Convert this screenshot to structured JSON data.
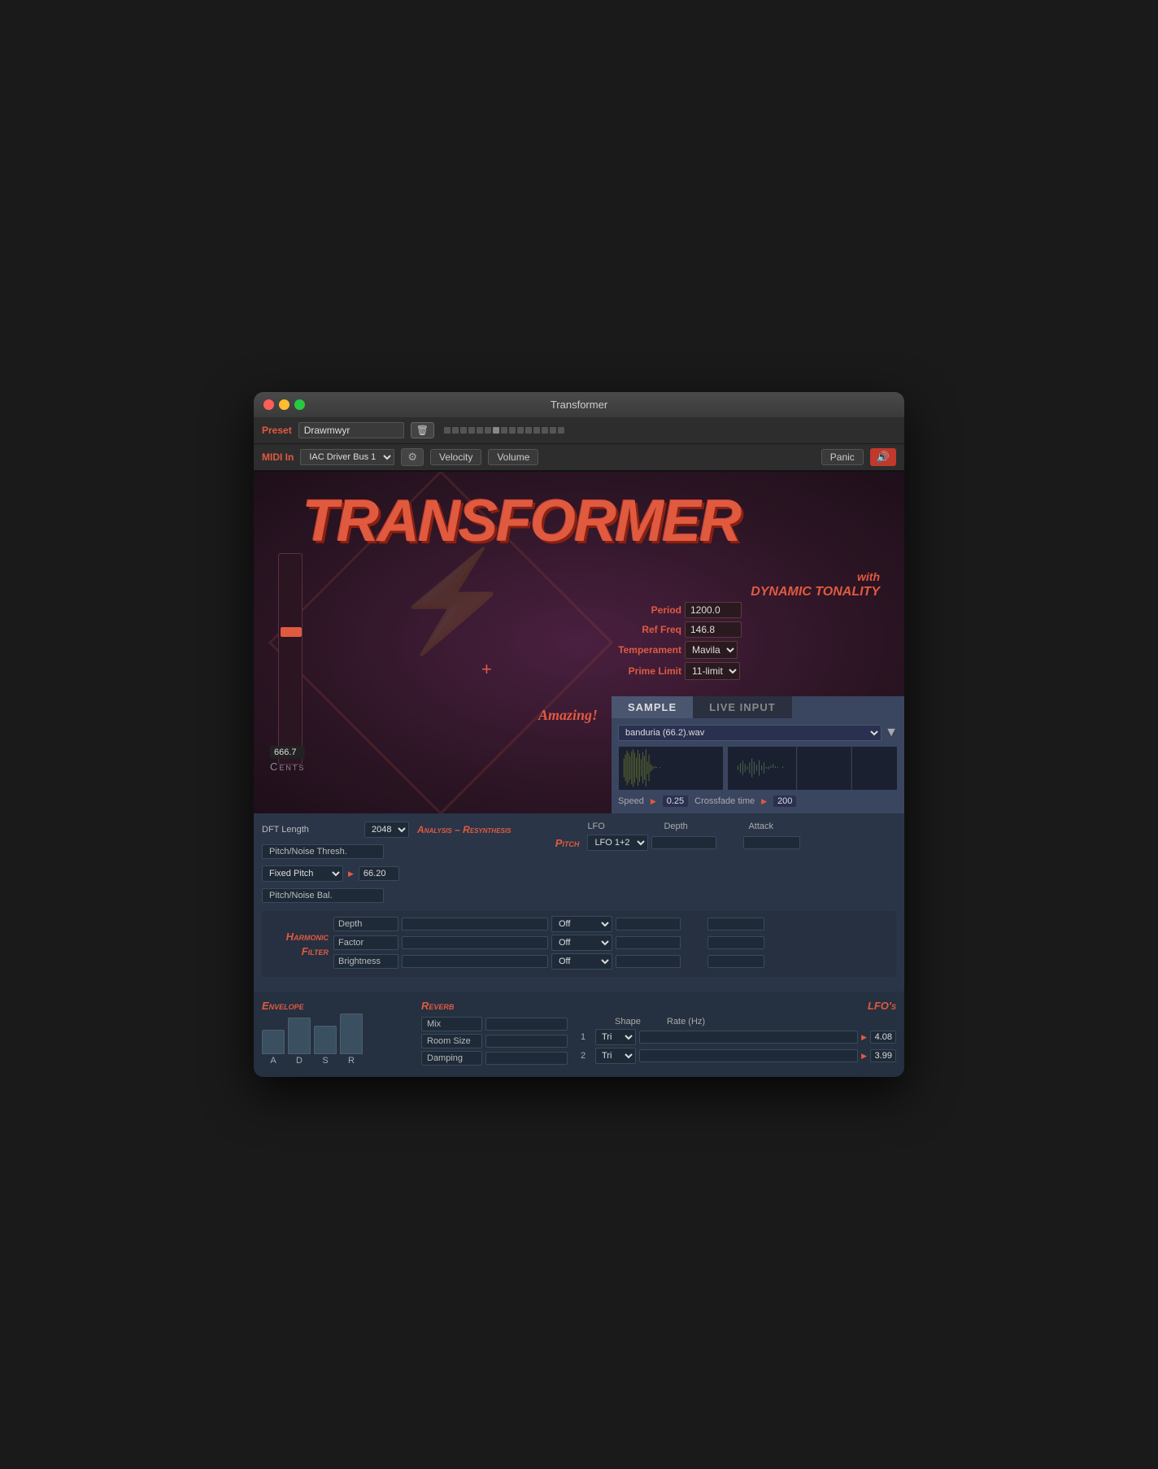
{
  "window": {
    "title": "Transformer"
  },
  "toolbar": {
    "preset_label": "Preset",
    "preset_value": "Drawmwyr",
    "midi_label": "MIDI In",
    "midi_value": "IAC Driver Bus 1",
    "velocity_btn": "Velocity",
    "volume_btn": "Volume",
    "panic_btn": "Panic",
    "gear_icon": "⚙"
  },
  "banner": {
    "title": "TRANSFORMER",
    "subtitle_with": "with",
    "subtitle_dynamic": "Dynamic Tonality"
  },
  "params": {
    "period_label": "Period",
    "period_value": "1200.0",
    "reffreq_label": "Ref Freq",
    "reffreq_value": "146.8",
    "temperament_label": "Temperament",
    "temperament_value": "Mavila",
    "primelimit_label": "Prime Limit",
    "primelimit_value": "11-limit"
  },
  "amazing": "Amazing!",
  "cents": {
    "value": "666.7",
    "label": "Cents"
  },
  "tabs": {
    "sample": "SAMPLE",
    "live_input": "LIVE INPUT"
  },
  "sample": {
    "file": "banduria (66.2).wav",
    "speed_label": "Speed",
    "speed_value": "0.25",
    "crossfade_label": "Crossfade time",
    "crossfade_value": "200"
  },
  "analysis": {
    "title": "Analysis – Resynthesis",
    "dft_label": "DFT Length",
    "dft_value": "2048",
    "pitch_noise_label": "Pitch/Noise Thresh.",
    "fixed_pitch_label": "Fixed Pitch",
    "fixed_pitch_select": "Fixed Pitch",
    "fixed_pitch_value": "66.20",
    "pitch_noise_bal_label": "Pitch/Noise Bal."
  },
  "lfo_section": {
    "lfo_label": "LFO",
    "depth_label": "Depth",
    "attack_label": "Attack",
    "pitch_label": "Pitch",
    "pitch_lfo_value": "LFO 1+2"
  },
  "harmonic": {
    "title": "Harmonic Filter",
    "depth_label": "Depth",
    "factor_label": "Factor",
    "brightness_label": "Brightness",
    "off": "Off"
  },
  "envelope": {
    "title": "Envelope",
    "a_label": "A",
    "d_label": "D",
    "s_label": "S",
    "r_label": "R"
  },
  "reverb": {
    "title": "Reverb",
    "mix_label": "Mix",
    "roomsize_label": "Room Size",
    "damping_label": "Damping"
  },
  "lfos": {
    "title": "LFO's",
    "shape_label": "Shape",
    "rate_label": "Rate (Hz)",
    "lfo1_num": "1",
    "lfo1_shape": "Tri",
    "lfo1_rate": "4.08",
    "lfo2_num": "2",
    "lfo2_shape": "Tri",
    "lfo2_rate": "3.99"
  }
}
